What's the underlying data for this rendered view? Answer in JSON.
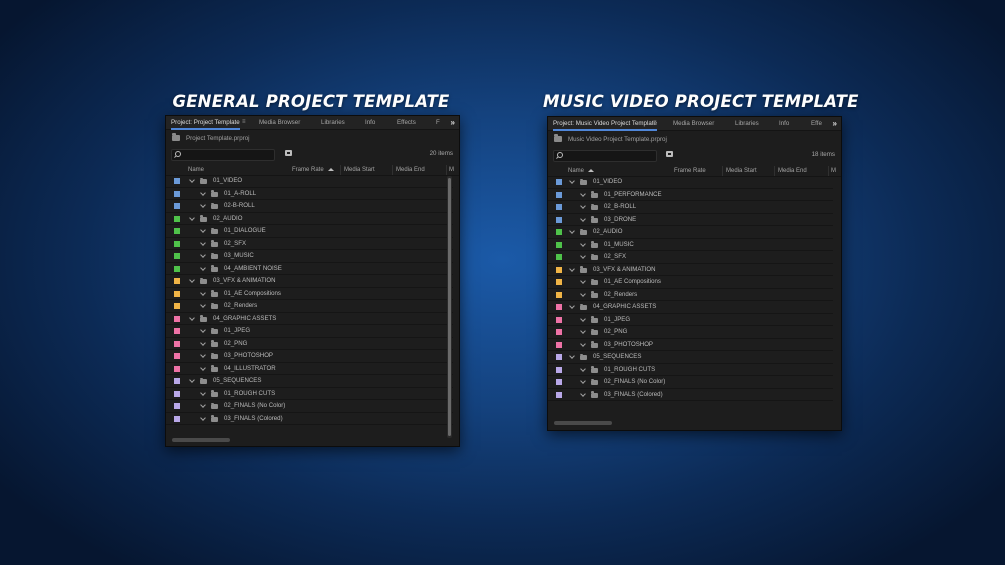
{
  "headings": {
    "left": "GENERAL PROJECT TEMPLATE",
    "right": "MUSIC VIDEO PROJECT TEMPLATE"
  },
  "colors": {
    "video": "#6b9ad8",
    "audio": "#4fc24a",
    "vfx": "#f0b446",
    "graphic": "#ee72a6",
    "sequences": "#b9a8e8",
    "tab_underline": "#4f86d8"
  },
  "left_panel": {
    "tabs": [
      "Project: Project Template",
      "Media Browser",
      "Libraries",
      "Info",
      "Effects",
      "F"
    ],
    "tab_menu_icon": "hamburger-icon",
    "overflow": "»",
    "file_name": "Project Template.prproj",
    "search_placeholder": "",
    "item_count": "20 items",
    "columns": [
      "Name",
      "Frame Rate",
      "Media Start",
      "Media End",
      "M"
    ],
    "rows": [
      {
        "label": "01_VIDEO",
        "level": 0,
        "color": "video"
      },
      {
        "label": "01_A-ROLL",
        "level": 1,
        "color": "video"
      },
      {
        "label": "02-B-ROLL",
        "level": 1,
        "color": "video"
      },
      {
        "label": "02_AUDIO",
        "level": 0,
        "color": "audio"
      },
      {
        "label": "01_DIALOGUE",
        "level": 1,
        "color": "audio"
      },
      {
        "label": "02_SFX",
        "level": 1,
        "color": "audio"
      },
      {
        "label": "03_MUSIC",
        "level": 1,
        "color": "audio"
      },
      {
        "label": "04_AMBIENT NOISE",
        "level": 1,
        "color": "audio"
      },
      {
        "label": "03_VFX & ANIMATION",
        "level": 0,
        "color": "vfx"
      },
      {
        "label": "01_AE Compositions",
        "level": 1,
        "color": "vfx"
      },
      {
        "label": "02_Renders",
        "level": 1,
        "color": "vfx"
      },
      {
        "label": "04_GRAPHIC ASSETS",
        "level": 0,
        "color": "graphic"
      },
      {
        "label": "01_JPEG",
        "level": 1,
        "color": "graphic"
      },
      {
        "label": "02_PNG",
        "level": 1,
        "color": "graphic"
      },
      {
        "label": "03_PHOTOSHOP",
        "level": 1,
        "color": "graphic"
      },
      {
        "label": "04_ILLUSTRATOR",
        "level": 1,
        "color": "graphic"
      },
      {
        "label": "05_SEQUENCES",
        "level": 0,
        "color": "sequences"
      },
      {
        "label": "01_ROUGH CUTS",
        "level": 1,
        "color": "sequences"
      },
      {
        "label": "02_FINALS (No Color)",
        "level": 1,
        "color": "sequences"
      },
      {
        "label": "03_FINALS (Colored)",
        "level": 1,
        "color": "sequences"
      }
    ]
  },
  "right_panel": {
    "tabs": [
      "Project: Music Video Project Template",
      "Media Browser",
      "Libraries",
      "Info",
      "Effe"
    ],
    "tab_menu_icon": "hamburger-icon",
    "overflow": "»",
    "file_name": "Music Video Project Template.prproj",
    "search_placeholder": "",
    "item_count": "18 items",
    "columns": [
      "Name",
      "Frame Rate",
      "Media Start",
      "Media End",
      "M"
    ],
    "rows": [
      {
        "label": "01_VIDEO",
        "level": 0,
        "color": "video"
      },
      {
        "label": "01_PERFORMANCE",
        "level": 1,
        "color": "video"
      },
      {
        "label": "02_B-ROLL",
        "level": 1,
        "color": "video"
      },
      {
        "label": "03_DRONE",
        "level": 1,
        "color": "video"
      },
      {
        "label": "02_AUDIO",
        "level": 0,
        "color": "audio"
      },
      {
        "label": "01_MUSIC",
        "level": 1,
        "color": "audio"
      },
      {
        "label": "02_SFX",
        "level": 1,
        "color": "audio"
      },
      {
        "label": "03_VFX & ANIMATION",
        "level": 0,
        "color": "vfx"
      },
      {
        "label": "01_AE Compositions",
        "level": 1,
        "color": "vfx"
      },
      {
        "label": "02_Renders",
        "level": 1,
        "color": "vfx"
      },
      {
        "label": "04_GRAPHIC ASSETS",
        "level": 0,
        "color": "graphic"
      },
      {
        "label": "01_JPEG",
        "level": 1,
        "color": "graphic"
      },
      {
        "label": "02_PNG",
        "level": 1,
        "color": "graphic"
      },
      {
        "label": "03_PHOTOSHOP",
        "level": 1,
        "color": "graphic"
      },
      {
        "label": "05_SEQUENCES",
        "level": 0,
        "color": "sequences"
      },
      {
        "label": "01_ROUGH CUTS",
        "level": 1,
        "color": "sequences"
      },
      {
        "label": "02_FINALS (No Color)",
        "level": 1,
        "color": "sequences"
      },
      {
        "label": "03_FINALS (Colored)",
        "level": 1,
        "color": "sequences"
      }
    ]
  }
}
